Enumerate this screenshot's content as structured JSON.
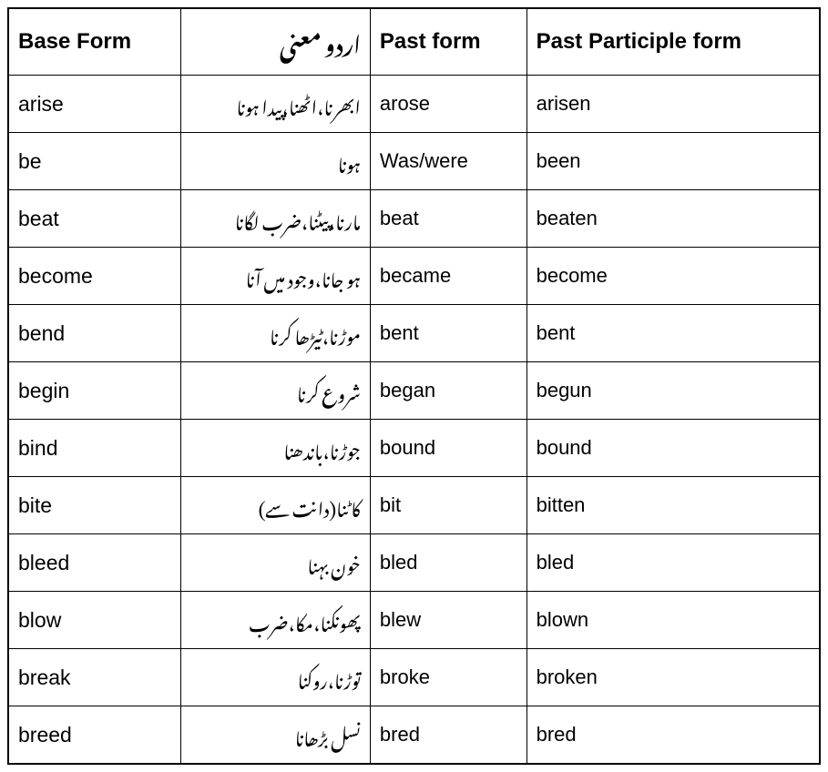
{
  "table": {
    "headers": {
      "base_form": "Base Form",
      "urdu": "اردو معنی",
      "past_form": "Past form",
      "past_participle": "Past Participle form"
    },
    "rows": [
      {
        "base": "arise",
        "urdu": "ابھرنا،اٹھنا،پیدا ہونا",
        "past": "arose",
        "participle": "arisen"
      },
      {
        "base": "be",
        "urdu": "ہونا",
        "past": "Was/were",
        "participle": "been"
      },
      {
        "base": "beat",
        "urdu": "مارنا،پیٹنا،ضرب لگانا",
        "past": "beat",
        "participle": "beaten"
      },
      {
        "base": "become",
        "urdu": "ہو جانا،وجود میں آنا",
        "past": "became",
        "participle": "become"
      },
      {
        "base": "bend",
        "urdu": "موڑنا،ٹیڑھا کرنا",
        "past": "bent",
        "participle": "bent"
      },
      {
        "base": "begin",
        "urdu": "شروع کرنا",
        "past": "began",
        "participle": "begun"
      },
      {
        "base": "bind",
        "urdu": "جوڑنا،باندھنا",
        "past": "bound",
        "participle": "bound"
      },
      {
        "base": "bite",
        "urdu": "کاٹنا(دانت سے)",
        "past": "bit",
        "participle": "bitten"
      },
      {
        "base": "bleed",
        "urdu": "خون بہنا",
        "past": "bled",
        "participle": "bled"
      },
      {
        "base": "blow",
        "urdu": "پھونکنا،مکا،ضرب",
        "past": "blew",
        "participle": "blown"
      },
      {
        "base": "break",
        "urdu": "توڑنا،روکنا",
        "past": "broke",
        "participle": "broken"
      },
      {
        "base": "breed",
        "urdu": "نسل بڑھانا",
        "past": "bred",
        "participle": "bred"
      }
    ]
  }
}
